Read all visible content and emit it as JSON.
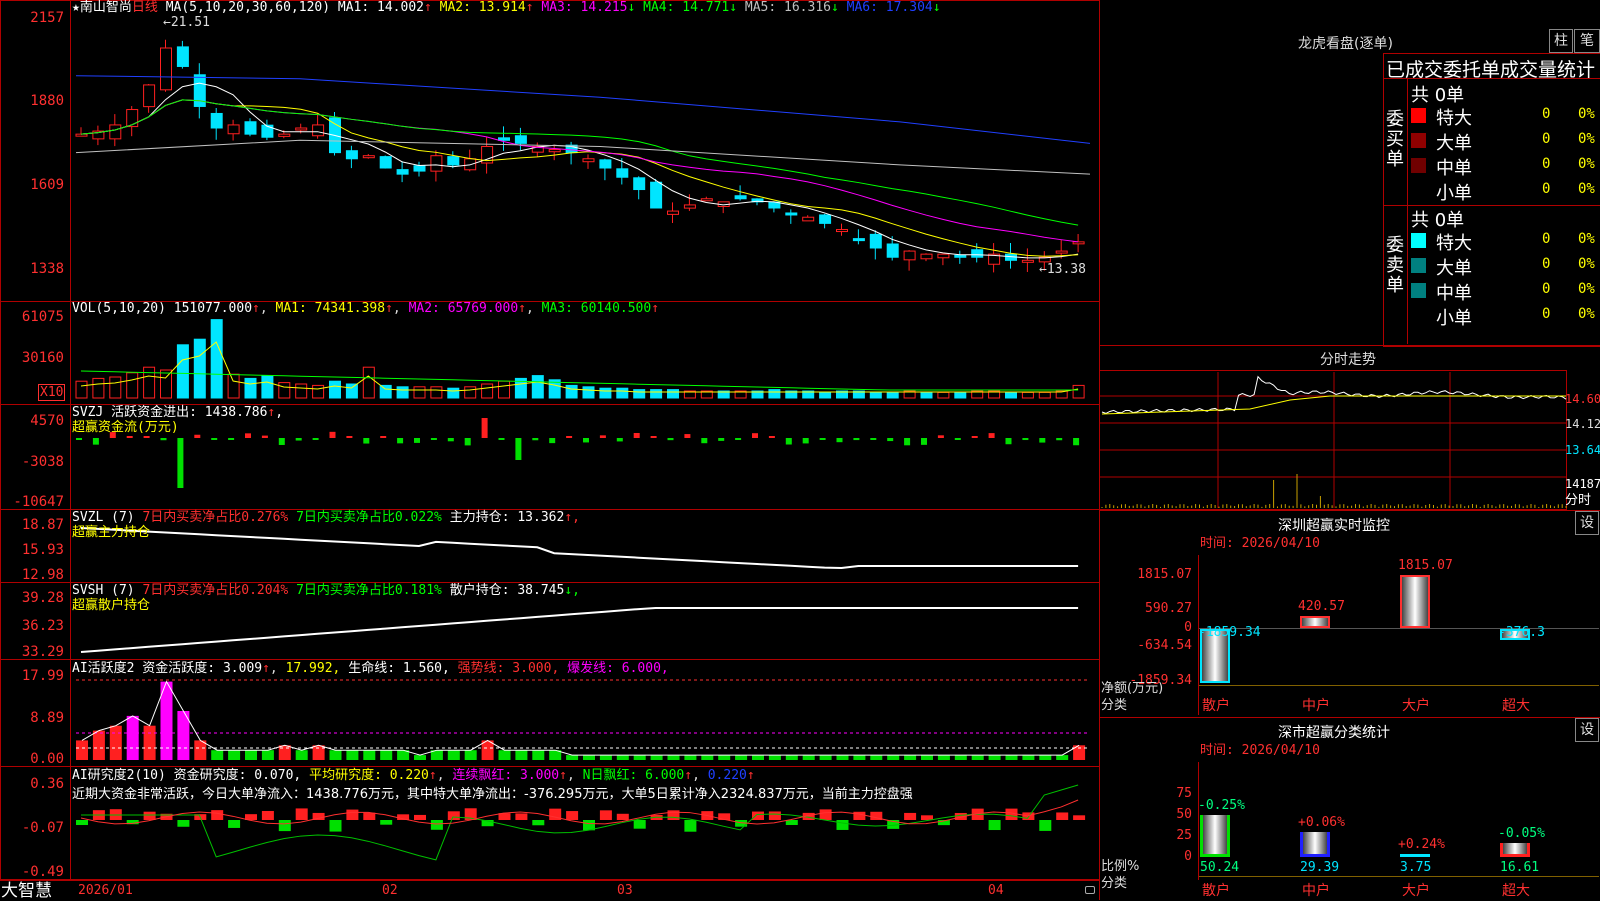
{
  "stock": {
    "star": "★",
    "name": "南山智尚",
    "period": "日线"
  },
  "price_panel": {
    "ma_title": "MA(5,10,20,30,60,120)",
    "ma": [
      {
        "label": "MA1: 14.002",
        "arrow": "↑",
        "color": "#ffffff"
      },
      {
        "label": "MA2: 13.914",
        "arrow": "↑",
        "color": "#ffff00"
      },
      {
        "label": "MA3: 14.215",
        "arrow": "↓",
        "color": "#ff00ff"
      },
      {
        "label": "MA4: 14.771",
        "arrow": "↓",
        "color": "#00ff00"
      },
      {
        "label": "MA5: 16.316",
        "arrow": "↓",
        "color": "#c0c0c0"
      },
      {
        "label": "MA6: 17.304",
        "arrow": "↓",
        "color": "#2040ff"
      }
    ],
    "y_ticks": [
      "2157",
      "1880",
      "1609",
      "1338"
    ],
    "high_mark": "21.51",
    "low_mark": "13.38",
    "colors": {
      "up": "#ff2020",
      "down": "#00e5ff"
    }
  },
  "vol_panel": {
    "title": "VOL(5,10,20)",
    "value": "151077.000",
    "arrow": "↑",
    "ma1": "MA1: 74341.398",
    "ma2": "MA2: 65769.000",
    "ma3": "MA3: 60140.500",
    "y_ticks": [
      "61075",
      "30160"
    ],
    "unit": "X10"
  },
  "svzj_panel": {
    "title": "SVZJ  活跃资金进出: 1438.786",
    "arrow": "↑",
    "subtitle": "超赢资金流(万元)",
    "y_ticks": [
      "4570",
      "-3038",
      "-10647"
    ]
  },
  "svzl_panel": {
    "title": "SVZL (7)",
    "t1": "7日内买卖净占比0.276%",
    "t2": "7日内买卖净占比0.022%",
    "t3": "主力持仓: 13.362",
    "arrow": "↑,",
    "subtitle": "超赢主力持仓",
    "y_ticks": [
      "18.87",
      "15.93",
      "12.98"
    ]
  },
  "svsh_panel": {
    "title": "SVSH (7)",
    "t1": "7日内买卖净占比0.204%",
    "t2": "7日内买卖净占比0.181%",
    "t3": "散户持仓: 38.745",
    "arrow": "↓,",
    "subtitle": "超赢散户持仓",
    "y_ticks": [
      "39.28",
      "36.23",
      "33.29"
    ]
  },
  "ai1_panel": {
    "t1": "AI活跃度2 资金活跃度: 3.009",
    "t2": "17.992,",
    "t3": "生命线: 1.560,",
    "t4": "强势线: 3.000,",
    "t5": "爆发线: 6.000,",
    "y_ticks": [
      "17.99",
      "8.89",
      "0.00"
    ]
  },
  "ai2_panel": {
    "t1": "AI研究度2(10) 资金研究度: 0.070,",
    "t2": "平均研究度: 0.220",
    "t3": "连续飘红: 3.000",
    "t4": "N日飘红: 6.000",
    "t5": "0.220",
    "comment": "近期大资金非常活跃，今日大单净流入：1438.776万元，其中特大单净流出：-376.295万元，大单5日累计净入2324.837万元，当前主力控盘强",
    "y_ticks": [
      "0.36",
      "-0.07",
      "-0.49"
    ]
  },
  "x_axis": {
    "labels": [
      "2026/01",
      "02",
      "03",
      "04"
    ]
  },
  "brand": "大智慧",
  "longhu": {
    "title": "龙虎看盘(逐单)",
    "tab1": "柱",
    "tab2": "笔",
    "header": "已成交委托单成交量统计",
    "buy": {
      "side": "委买单",
      "total": "共 0单",
      "rows": [
        {
          "name": "特大",
          "vol": "0",
          "pct": "0%",
          "color": "#ff0000"
        },
        {
          "name": "大单",
          "vol": "0",
          "pct": "0%",
          "color": "#900000"
        },
        {
          "name": "中单",
          "vol": "0",
          "pct": "0%",
          "color": "#700000"
        },
        {
          "name": "小单",
          "vol": "0",
          "pct": "0%",
          "color": "#000000"
        }
      ]
    },
    "sell": {
      "side": "委卖单",
      "total": "共 0单",
      "rows": [
        {
          "name": "特大",
          "vol": "0",
          "pct": "0%",
          "color": "#00ffff"
        },
        {
          "name": "大单",
          "vol": "0",
          "pct": "0%",
          "color": "#008080"
        },
        {
          "name": "中单",
          "vol": "0",
          "pct": "0%",
          "color": "#008080"
        },
        {
          "name": "小单",
          "vol": "0",
          "pct": "0%",
          "color": "#000000"
        }
      ]
    }
  },
  "fenshi": {
    "title": "分时走势",
    "p1": "14.60",
    "p2": "14.12",
    "p3": "13.64",
    "vol": "14187",
    "unit": "分时"
  },
  "monitor": {
    "title": "深圳超赢实时监控",
    "btn": "设",
    "time": "时间: 2026/04/10",
    "y_ticks": [
      "1815.07",
      "590.27",
      "0",
      "-634.54",
      "-1859.34"
    ],
    "left1": "净额(万元)",
    "left2": "分类",
    "bars": [
      {
        "cat": "散户",
        "value": -1859.34,
        "label": "-1859.34"
      },
      {
        "cat": "中户",
        "value": 420.57,
        "label": "420.57"
      },
      {
        "cat": "大户",
        "value": 1815.07,
        "label": "1815.07"
      },
      {
        "cat": "超大",
        "value": -376.3,
        "label": "-376.3"
      }
    ]
  },
  "classify": {
    "title": "深市超赢分类统计",
    "btn": "设",
    "time": "时间: 2026/04/10",
    "y_ticks": [
      "75",
      "50",
      "25",
      "0"
    ],
    "left1": "比例%",
    "left2": "分类",
    "bars": [
      {
        "cat": "散户",
        "value": 50.24,
        "label": "50.24",
        "delta": "-0.25%",
        "color": "#00e000",
        "dcolor": "#00ff80"
      },
      {
        "cat": "中户",
        "value": 29.39,
        "label": "29.39",
        "delta": "+0.06%",
        "color": "#2020ff",
        "dcolor": "#ff3030"
      },
      {
        "cat": "大户",
        "value": 3.75,
        "label": "3.75",
        "delta": "+0.24%",
        "color": "#00e5ff",
        "dcolor": "#ff3030"
      },
      {
        "cat": "超大",
        "value": 16.61,
        "label": "16.61",
        "delta": "-0.05%",
        "color": "#ff2020",
        "dcolor": "#00ff80"
      }
    ]
  }
}
